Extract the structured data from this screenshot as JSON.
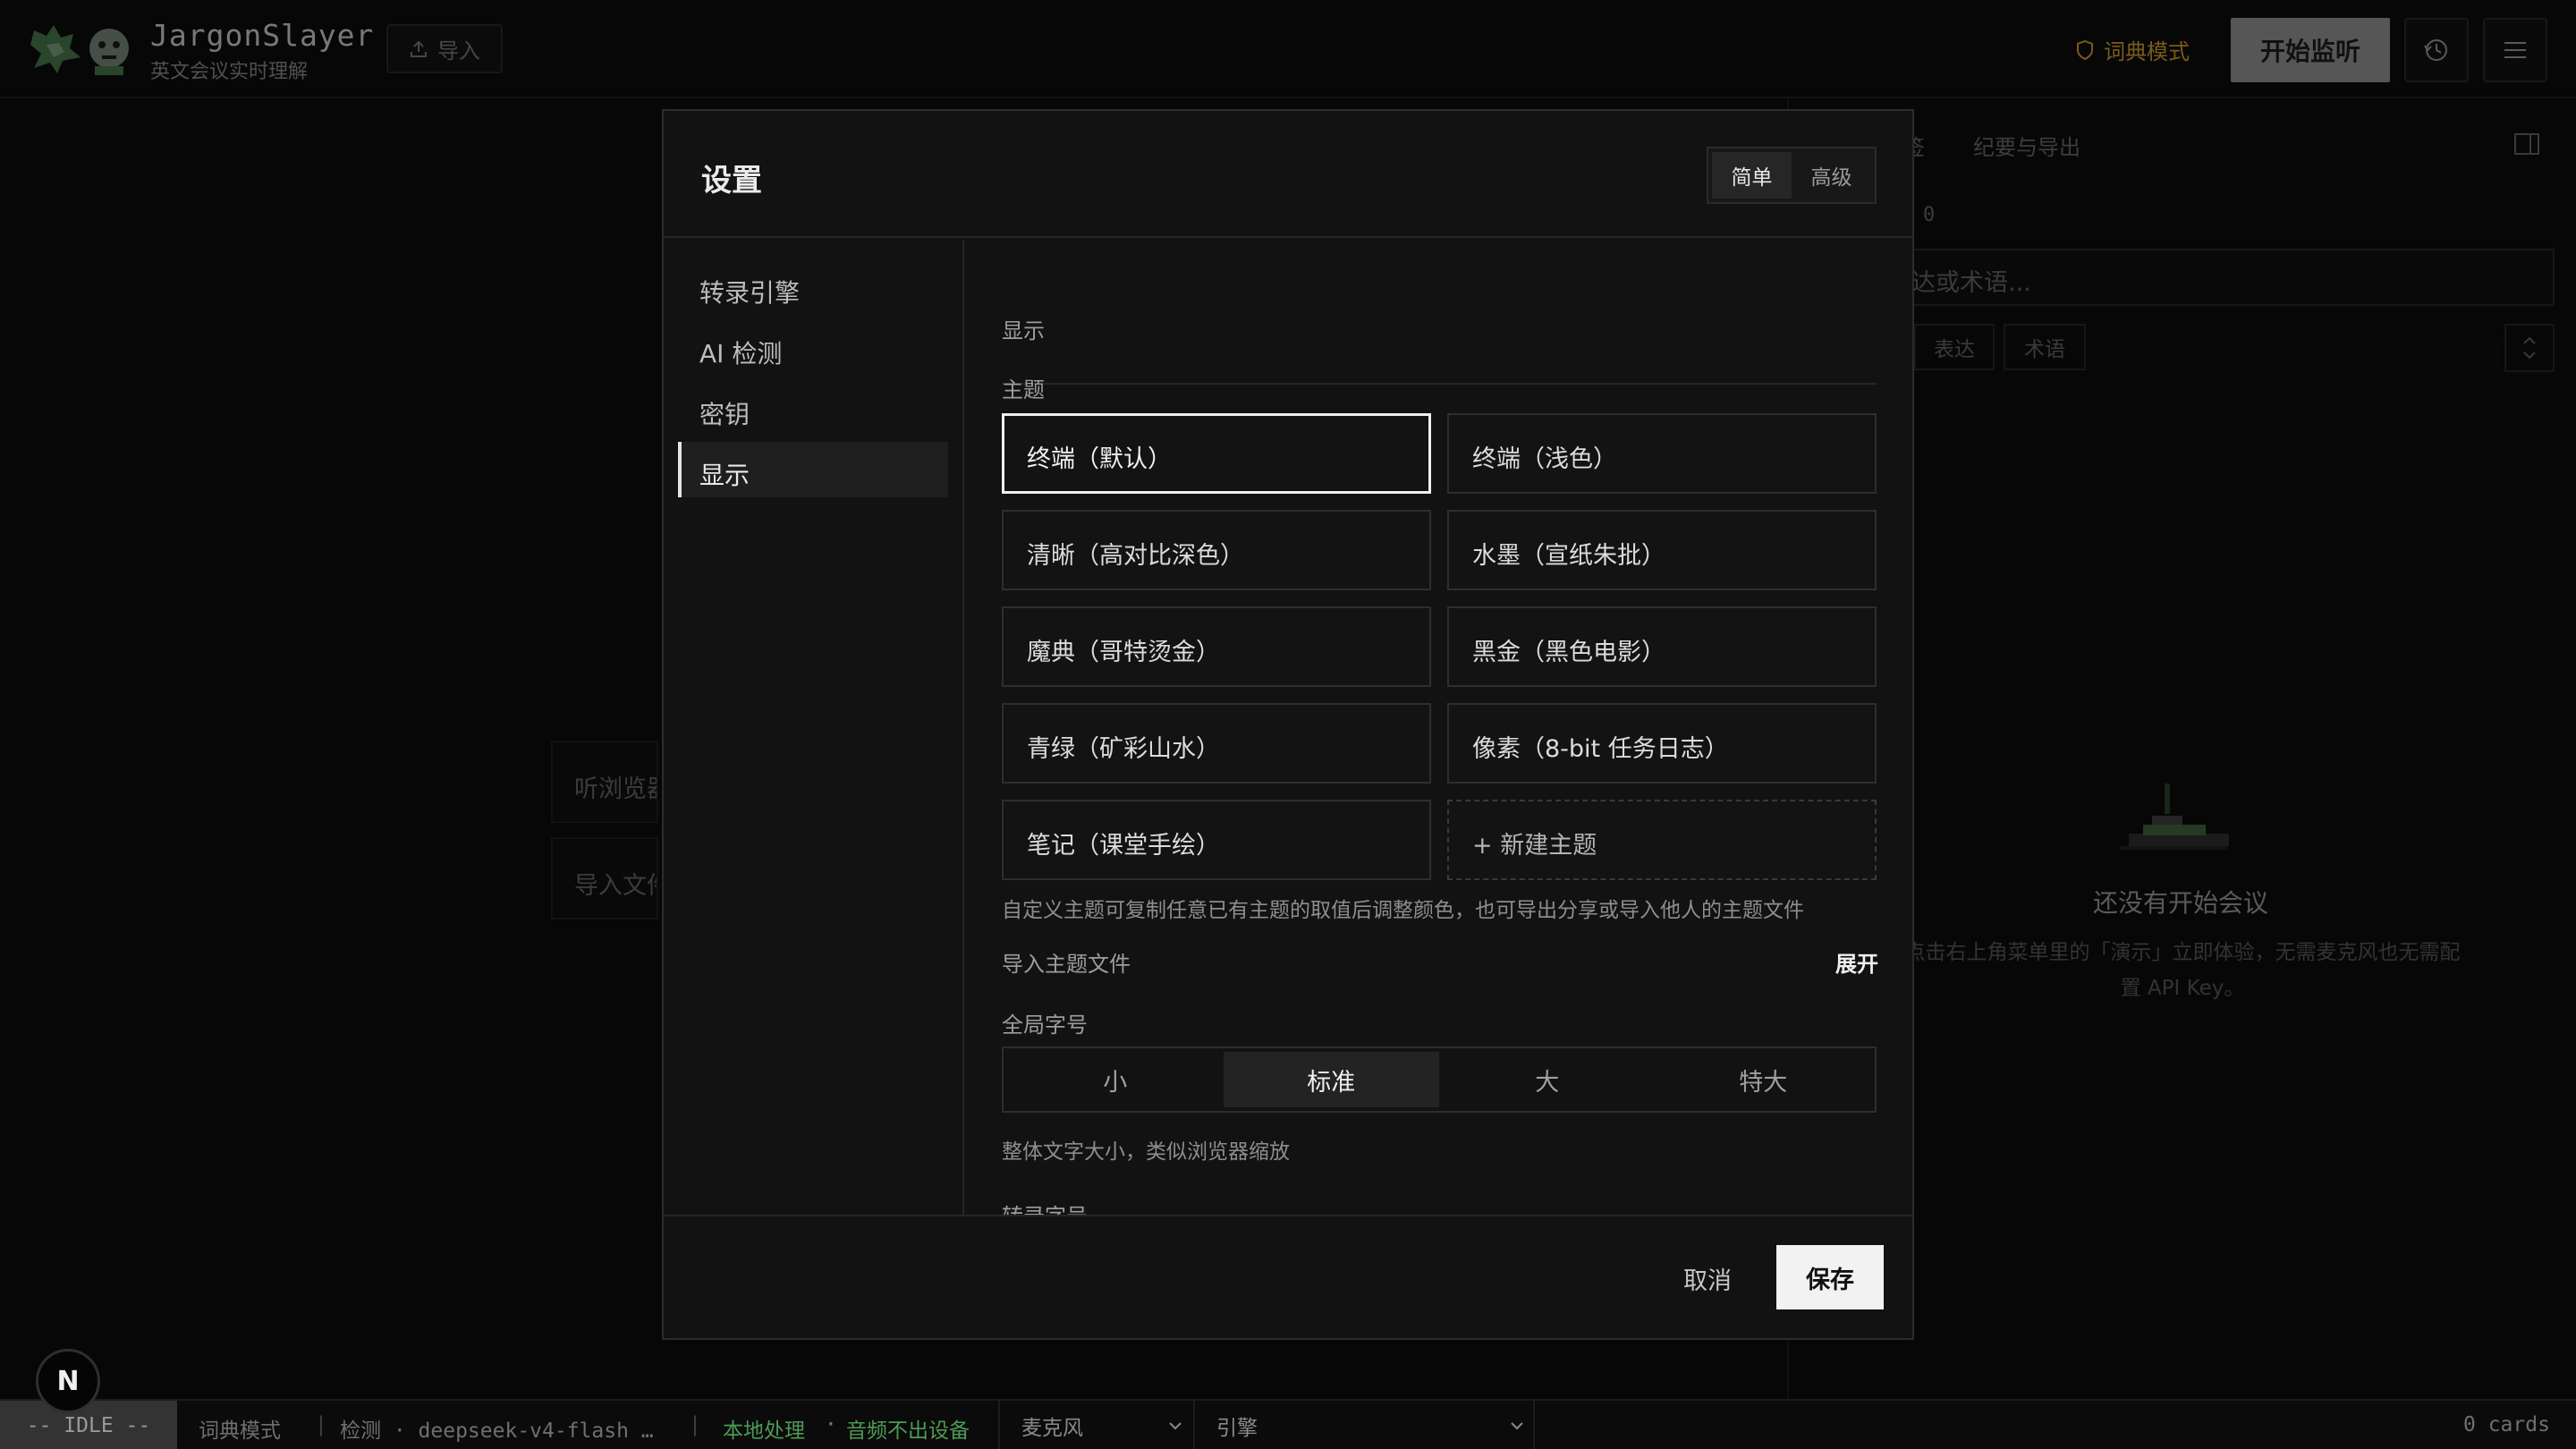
{
  "app": {
    "name": "JargonSlayer",
    "subtitle": "英文会议实时理解",
    "import_label": "导入",
    "dict_mode_label": "词典模式",
    "start_label": "开始监听"
  },
  "right_panel": {
    "tab_partial": "签",
    "tab_minutes": "纪要与导出",
    "count_text": "0",
    "search_placeholder": "达或术语...",
    "chip_expression": "表达",
    "chip_term": "术语",
    "empty_title": "还没有开始会议",
    "empty_desc": "点击右上角菜单里的「演示」立即体验，无需麦克风也无需配置 API Key。"
  },
  "left_bg": {
    "card1": "听浏览器",
    "card2": "导入文件"
  },
  "modal": {
    "title": "设置",
    "mode_simple": "简单",
    "mode_advanced": "高级",
    "nav": [
      {
        "label": "转录引擎"
      },
      {
        "label": "AI 检测"
      },
      {
        "label": "密钥"
      },
      {
        "label": "显示"
      }
    ],
    "section_display": "显示",
    "theme_label": "主题",
    "themes": [
      {
        "label": "终端（默认）"
      },
      {
        "label": "终端（浅色）"
      },
      {
        "label": "清晰（高对比深色）"
      },
      {
        "label": "水墨（宣纸朱批）"
      },
      {
        "label": "魔典（哥特烫金）"
      },
      {
        "label": "黑金（黑色电影）"
      },
      {
        "label": "青绿（矿彩山水）"
      },
      {
        "label": "像素（8-bit 任务日志）"
      },
      {
        "label": "笔记（课堂手绘）"
      },
      {
        "label": "+ 新建主题"
      }
    ],
    "selected_theme_index": 0,
    "theme_help": "自定义主题可复制任意已有主题的取值后调整颜色，也可导出分享或导入他人的主题文件",
    "import_theme_label": "导入主题文件",
    "expand_label": "展开",
    "global_font_label": "全局字号",
    "font_sizes": [
      {
        "label": "小"
      },
      {
        "label": "标准"
      },
      {
        "label": "大"
      },
      {
        "label": "特大"
      }
    ],
    "selected_font_size": "标准",
    "font_help": "整体文字大小，类似浏览器缩放",
    "transcript_font_label": "转录字号",
    "cancel_label": "取消",
    "save_label": "保存"
  },
  "status": {
    "state": "-- IDLE --",
    "mode": "词典模式",
    "detect": "检测 · deepseek-v4-flash …",
    "local": "本地处理",
    "audio": "音频不出设备",
    "mic_select": "麦克风",
    "engine_select": "引擎",
    "cards": "0 cards"
  },
  "colors": {
    "accent_gold": "#b98d2a",
    "status_green": "#4d9a55",
    "primary_button": "#f2f2f2"
  }
}
